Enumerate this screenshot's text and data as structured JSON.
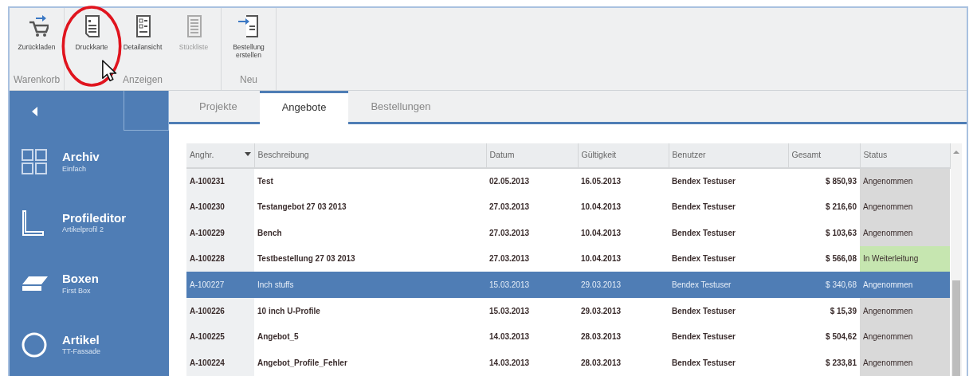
{
  "ribbon": {
    "groups": [
      {
        "label": "Warenkorb",
        "buttons": [
          {
            "kind": "cart",
            "label": "Zurückladen",
            "disabled": false,
            "highlighted": false
          }
        ]
      },
      {
        "label": "Anzeigen",
        "buttons": [
          {
            "kind": "list",
            "label": "Druckkarte",
            "disabled": false,
            "highlighted": true
          },
          {
            "kind": "detail",
            "label": "Detailansicht",
            "disabled": false,
            "highlighted": false
          },
          {
            "kind": "lines",
            "label": "Stückliste",
            "disabled": true,
            "highlighted": false
          }
        ]
      },
      {
        "label": "Neu",
        "buttons": [
          {
            "kind": "order",
            "label": "Bestellung erstellen",
            "disabled": false,
            "highlighted": false
          }
        ]
      }
    ]
  },
  "sidebar": {
    "items": [
      {
        "kind": "grid",
        "title": "Archiv",
        "subtitle": "Einfach"
      },
      {
        "kind": "profile",
        "title": "Profileditor",
        "subtitle": "Artikelprofil 2"
      },
      {
        "kind": "box",
        "title": "Boxen",
        "subtitle": "First Box"
      },
      {
        "kind": "circle",
        "title": "Artikel",
        "subtitle": "TT-Fassade"
      }
    ]
  },
  "tabs": [
    {
      "label": "Projekte",
      "selected": false
    },
    {
      "label": "Angebote",
      "selected": true
    },
    {
      "label": "Bestellungen",
      "selected": false
    }
  ],
  "table": {
    "columns": [
      "Anghr.",
      "Beschreibung",
      "Datum",
      "Gültigkeit",
      "Benutzer",
      "Gesamt",
      "Status"
    ],
    "rows": [
      {
        "cells": [
          "A-100231",
          "Test",
          "02.05.2013",
          "16.05.2013",
          "Bendex Testuser",
          "$ 850,93",
          "Angenommen"
        ],
        "selected": false,
        "color": "#d9d9d9"
      },
      {
        "cells": [
          "A-100230",
          "Testangebot 27 03 2013",
          "27.03.2013",
          "10.04.2013",
          "Bendex Testuser",
          "$ 216,60",
          "Angenommen"
        ],
        "selected": false,
        "color": "#d9d9d9"
      },
      {
        "cells": [
          "A-100229",
          "Bench",
          "27.03.2013",
          "10.04.2013",
          "Bendex Testuser",
          "$ 103,63",
          "Angenommen"
        ],
        "selected": false,
        "color": "#d9d9d9"
      },
      {
        "cells": [
          "A-100228",
          "Testbestellung 27 03 2013",
          "27.03.2013",
          "10.04.2013",
          "Bendex Testuser",
          "$ 566,08",
          "In Weiterleitung"
        ],
        "selected": false,
        "color": "#c6e6b0"
      },
      {
        "cells": [
          "A-100227",
          "Inch stuffs",
          "15.03.2013",
          "29.03.2013",
          "Bendex Testuser",
          "$ 340,68",
          "Angenommen"
        ],
        "selected": true
      },
      {
        "cells": [
          "A-100226",
          "10 inch U-Profile",
          "15.03.2013",
          "29.03.2013",
          "Bendex Testuser",
          "$ 15,39",
          "Angenommen"
        ],
        "selected": false,
        "color": "#d9d9d9"
      },
      {
        "cells": [
          "A-100225",
          "Angebot_5",
          "14.03.2013",
          "28.03.2013",
          "Bendex Testuser",
          "$ 504,62",
          "Angenommen"
        ],
        "selected": false,
        "color": "#d9d9d9"
      },
      {
        "cells": [
          "A-100224",
          "Angebot_Profile_Fehler",
          "14.03.2013",
          "28.03.2013",
          "Bendex Testuser",
          "$ 233,81",
          "Angenommen"
        ],
        "selected": false,
        "color": "#d9d9d9"
      }
    ]
  }
}
